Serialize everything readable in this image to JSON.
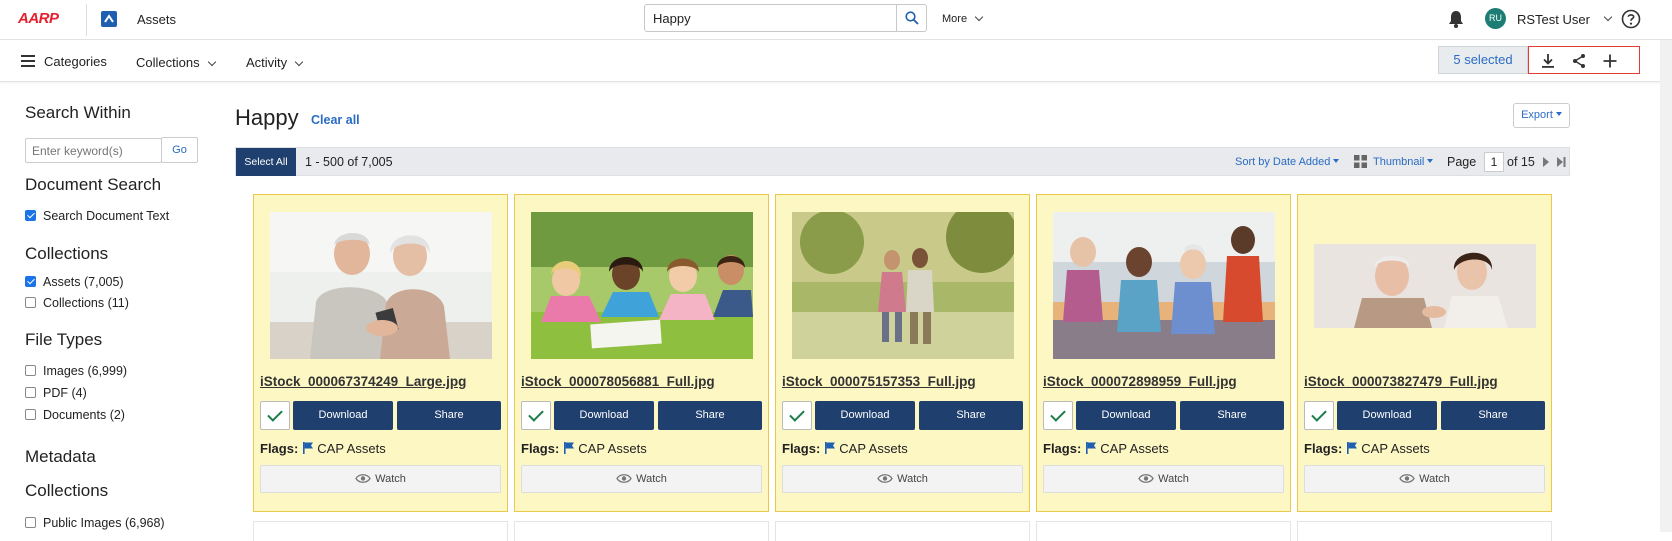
{
  "header": {
    "logo": "AARP",
    "app_name": "Assets",
    "search": {
      "value": "Happy",
      "placeholder": "Search"
    },
    "more_label": "More",
    "user": {
      "initials": "RU",
      "name": "RSTest User"
    }
  },
  "subnav": {
    "categories_label": "Categories",
    "collections_label": "Collections",
    "activity_label": "Activity",
    "selected_label": "5 selected"
  },
  "sidebar": {
    "search_within": {
      "heading": "Search Within",
      "placeholder": "Enter keyword(s)",
      "go_label": "Go"
    },
    "document_search": {
      "heading": "Document Search",
      "items": [
        {
          "label": "Search Document Text",
          "checked": true
        }
      ]
    },
    "collections": {
      "heading": "Collections",
      "items": [
        {
          "label": "Assets (7,005)",
          "checked": true
        },
        {
          "label": "Collections (11)",
          "checked": false
        }
      ]
    },
    "file_types": {
      "heading": "File Types",
      "items": [
        {
          "label": "Images (6,999)",
          "checked": false
        },
        {
          "label": "PDF (4)",
          "checked": false
        },
        {
          "label": "Documents (2)",
          "checked": false
        }
      ]
    },
    "metadata": {
      "heading": "Metadata"
    },
    "metadata_collections": {
      "heading": "Collections",
      "items": [
        {
          "label": "Public Images (6,968)",
          "checked": false
        }
      ]
    }
  },
  "main": {
    "title": "Happy",
    "clear_all_label": "Clear all",
    "export_label": "Export",
    "toolbar": {
      "select_all_label": "Select All",
      "range": "1 - 500 of 7,005",
      "sort_label": "Sort by Date Added",
      "view_label": "Thumbnail",
      "page_label": "Page",
      "page_value": "1",
      "page_of": "of 15"
    },
    "card_labels": {
      "download": "Download",
      "share": "Share",
      "flags": "Flags:",
      "watch": "Watch"
    },
    "cards": [
      {
        "filename": "iStock_000067374249_Large.jpg",
        "flag": "CAP Assets",
        "selected": true
      },
      {
        "filename": "iStock_000078056881_Full.jpg",
        "flag": "CAP Assets",
        "selected": true
      },
      {
        "filename": "iStock_000075157353_Full.jpg",
        "flag": "CAP Assets",
        "selected": true
      },
      {
        "filename": "iStock_000072898959_Full.jpg",
        "flag": "CAP Assets",
        "selected": true
      },
      {
        "filename": "iStock_000073827479_Full.jpg",
        "flag": "CAP Assets",
        "selected": true
      }
    ]
  },
  "colors": {
    "brand_red": "#e4202e",
    "navy_button": "#1f3f6e",
    "link_blue": "#2a6cc3",
    "card_bg": "#fdf7c4",
    "card_border": "#e8c94d",
    "selection_outline": "#e23c2e"
  },
  "icons": {
    "app": "assets-app-icon",
    "search": "search-icon",
    "notifications": "bell-icon",
    "help": "help-circle-icon",
    "menu": "hamburger-icon",
    "download": "download-icon",
    "share": "share-icon",
    "add": "plus-icon",
    "view": "grid-icon",
    "flag": "flag-icon",
    "watch": "eye-icon"
  }
}
